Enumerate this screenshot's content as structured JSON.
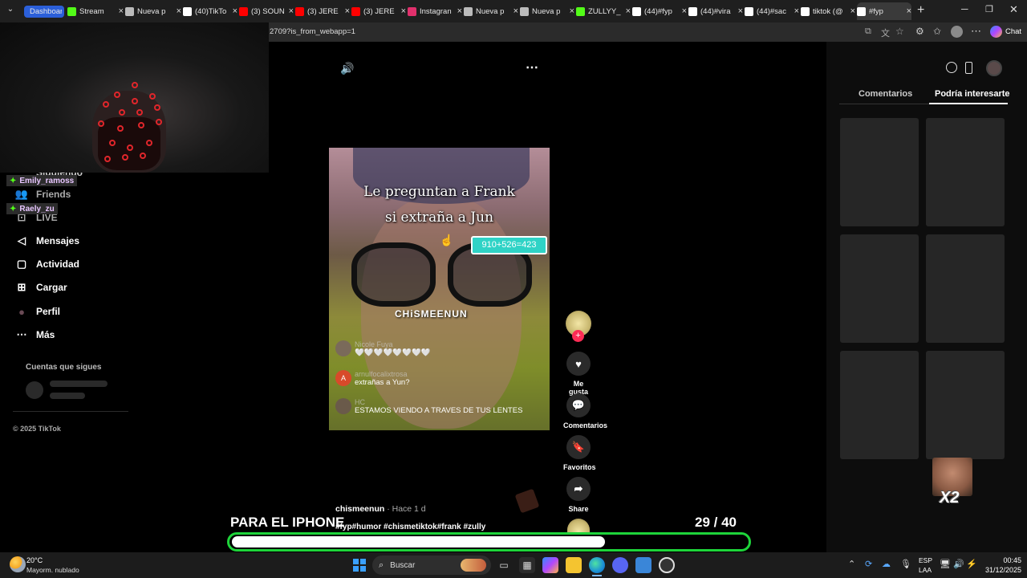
{
  "browser": {
    "tabs": [
      {
        "label": "Dashboard",
        "icon": "dashboard-tab-icon",
        "color": "#2b5fd9"
      },
      {
        "label": "Stream",
        "icon": "kick-icon",
        "color": "#53fc18"
      },
      {
        "label": "Nueva p",
        "icon": "new-tab-icon",
        "color": "#bbbbbb"
      },
      {
        "label": "(40)TikTo",
        "icon": "tiktok-icon",
        "color": "#ffffff"
      },
      {
        "label": "(3) SOUN",
        "icon": "youtube-icon",
        "color": "#ff0000"
      },
      {
        "label": "(3) JERE",
        "icon": "youtube-icon",
        "color": "#ff0000"
      },
      {
        "label": "(3) JERE",
        "icon": "youtube-icon",
        "color": "#ff0000"
      },
      {
        "label": "Instagran",
        "icon": "instagram-icon",
        "color": "#e1306c"
      },
      {
        "label": "Nueva p",
        "icon": "new-tab-icon",
        "color": "#bbbbbb"
      },
      {
        "label": "Nueva p",
        "icon": "new-tab-icon",
        "color": "#bbbbbb"
      },
      {
        "label": "ZULLYY_",
        "icon": "kick-icon",
        "color": "#53fc18"
      },
      {
        "label": "(44)#fyp",
        "icon": "tiktok-icon",
        "color": "#ffffff"
      },
      {
        "label": "(44)#vira",
        "icon": "tiktok-icon",
        "color": "#ffffff"
      },
      {
        "label": "(44)#sac",
        "icon": "tiktok-icon",
        "color": "#ffffff"
      },
      {
        "label": "tiktok (@",
        "icon": "tiktok-icon",
        "color": "#ffffff"
      },
      {
        "label": "#fyp",
        "icon": "tiktok-icon",
        "color": "#ffffff",
        "active": true
      }
    ],
    "address_fragment": "2709?is_from_webapp=1",
    "chat_label": "Chat"
  },
  "sidebar": {
    "partial_item": "Siguiendo",
    "items": [
      {
        "label": "Friends",
        "icon": "friends-icon"
      },
      {
        "label": "LIVE",
        "icon": "live-icon"
      },
      {
        "label": "Mensajes",
        "icon": "messages-icon"
      },
      {
        "label": "Actividad",
        "icon": "activity-icon"
      },
      {
        "label": "Cargar",
        "icon": "upload-icon"
      },
      {
        "label": "Perfil",
        "icon": "profile-icon"
      },
      {
        "label": "Más",
        "icon": "more-icon"
      }
    ],
    "following_title": "Cuentas que sigues",
    "copyright": "© 2025 TikTok"
  },
  "stream_overlay": {
    "chat_users": [
      "Emily_ramoss",
      "Raely_zu"
    ]
  },
  "video": {
    "caption_line1": "Le preguntan a Frank",
    "caption_line2": "si extraña a Jun",
    "math_badge": "910+526=423",
    "watermark": "CHiSMEENUN",
    "comments": [
      {
        "user": "Nicole Fuya",
        "text": "🤍🤍🤍🤍🤍🤍🤍🤍",
        "avatar_color": "#7a6a5a"
      },
      {
        "user": "arnulfocalixtrosa",
        "text": "extrañas a Yun?",
        "avatar_color": "#d84a2a",
        "avatar_letter": "A"
      },
      {
        "user": "HC",
        "text": "ESTAMOS VIENDO A TRAVES DE TUS LENTES",
        "avatar_color": "#6a5a4a"
      }
    ],
    "author": "chismeenun",
    "time_ago": "· Hace 1 d",
    "hashtags": "#fyp#humor #chismetiktok#frank #zully"
  },
  "actions": {
    "like_label": "Me gusta",
    "comments_label": "Comentarios",
    "favorites_label": "Favoritos",
    "share_label": "Share"
  },
  "right_panel": {
    "tab_comments": "Comentarios",
    "tab_interest": "Podría interesarte"
  },
  "overlay": {
    "banner": "PARA EL IPHONE",
    "counter_current": "29",
    "counter_total": "/ 40",
    "progress_fraction": 0.725,
    "multiplier": "X2"
  },
  "taskbar": {
    "temperature": "20°C",
    "weather": "Mayorm. nublado",
    "search_placeholder": "Buscar",
    "language": "ESP",
    "region": "LAA",
    "time": "00:45",
    "date": "31/12/2025"
  }
}
